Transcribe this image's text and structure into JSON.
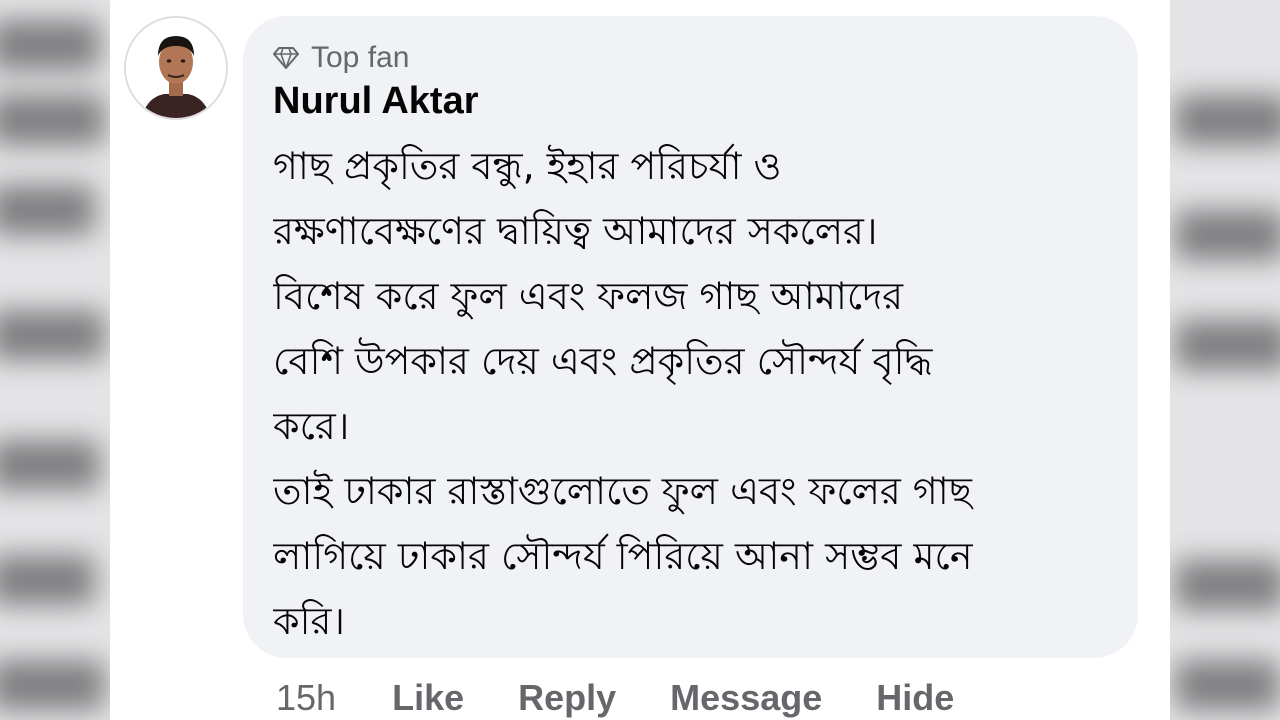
{
  "comment": {
    "badge": {
      "icon": "diamond-icon",
      "label": "Top fan"
    },
    "author": "Nurul Aktar",
    "avatar": "profile-photo",
    "text_lines": [
      "গাছ প্রকৃতির বন্ধু, ইহার পরিচর্যা ও",
      "রক্ষণাবেক্ষণের দ্বায়িত্ব আমাদের সকলের।",
      "বিশেষ করে ফুল এবং ফলজ গাছ আমাদের",
      "বেশি উপকার দেয় এবং প্রকৃতির সৌন্দর্য বৃদ্ধি",
      "করে।",
      "তাই ঢাকার রাস্তাগুলোতে ফুল এবং ফলের গাছ",
      "লাগিয়ে ঢাকার সৌন্দর্য পিরিয়ে আনা সম্ভব মনে",
      "করি।"
    ]
  },
  "actions": {
    "timestamp": "15h",
    "like": "Like",
    "reply": "Reply",
    "message": "Message",
    "hide": "Hide"
  },
  "colors": {
    "bubble": "#f0f2f5",
    "secondary_text": "#65676b",
    "primary_text": "#050505"
  }
}
